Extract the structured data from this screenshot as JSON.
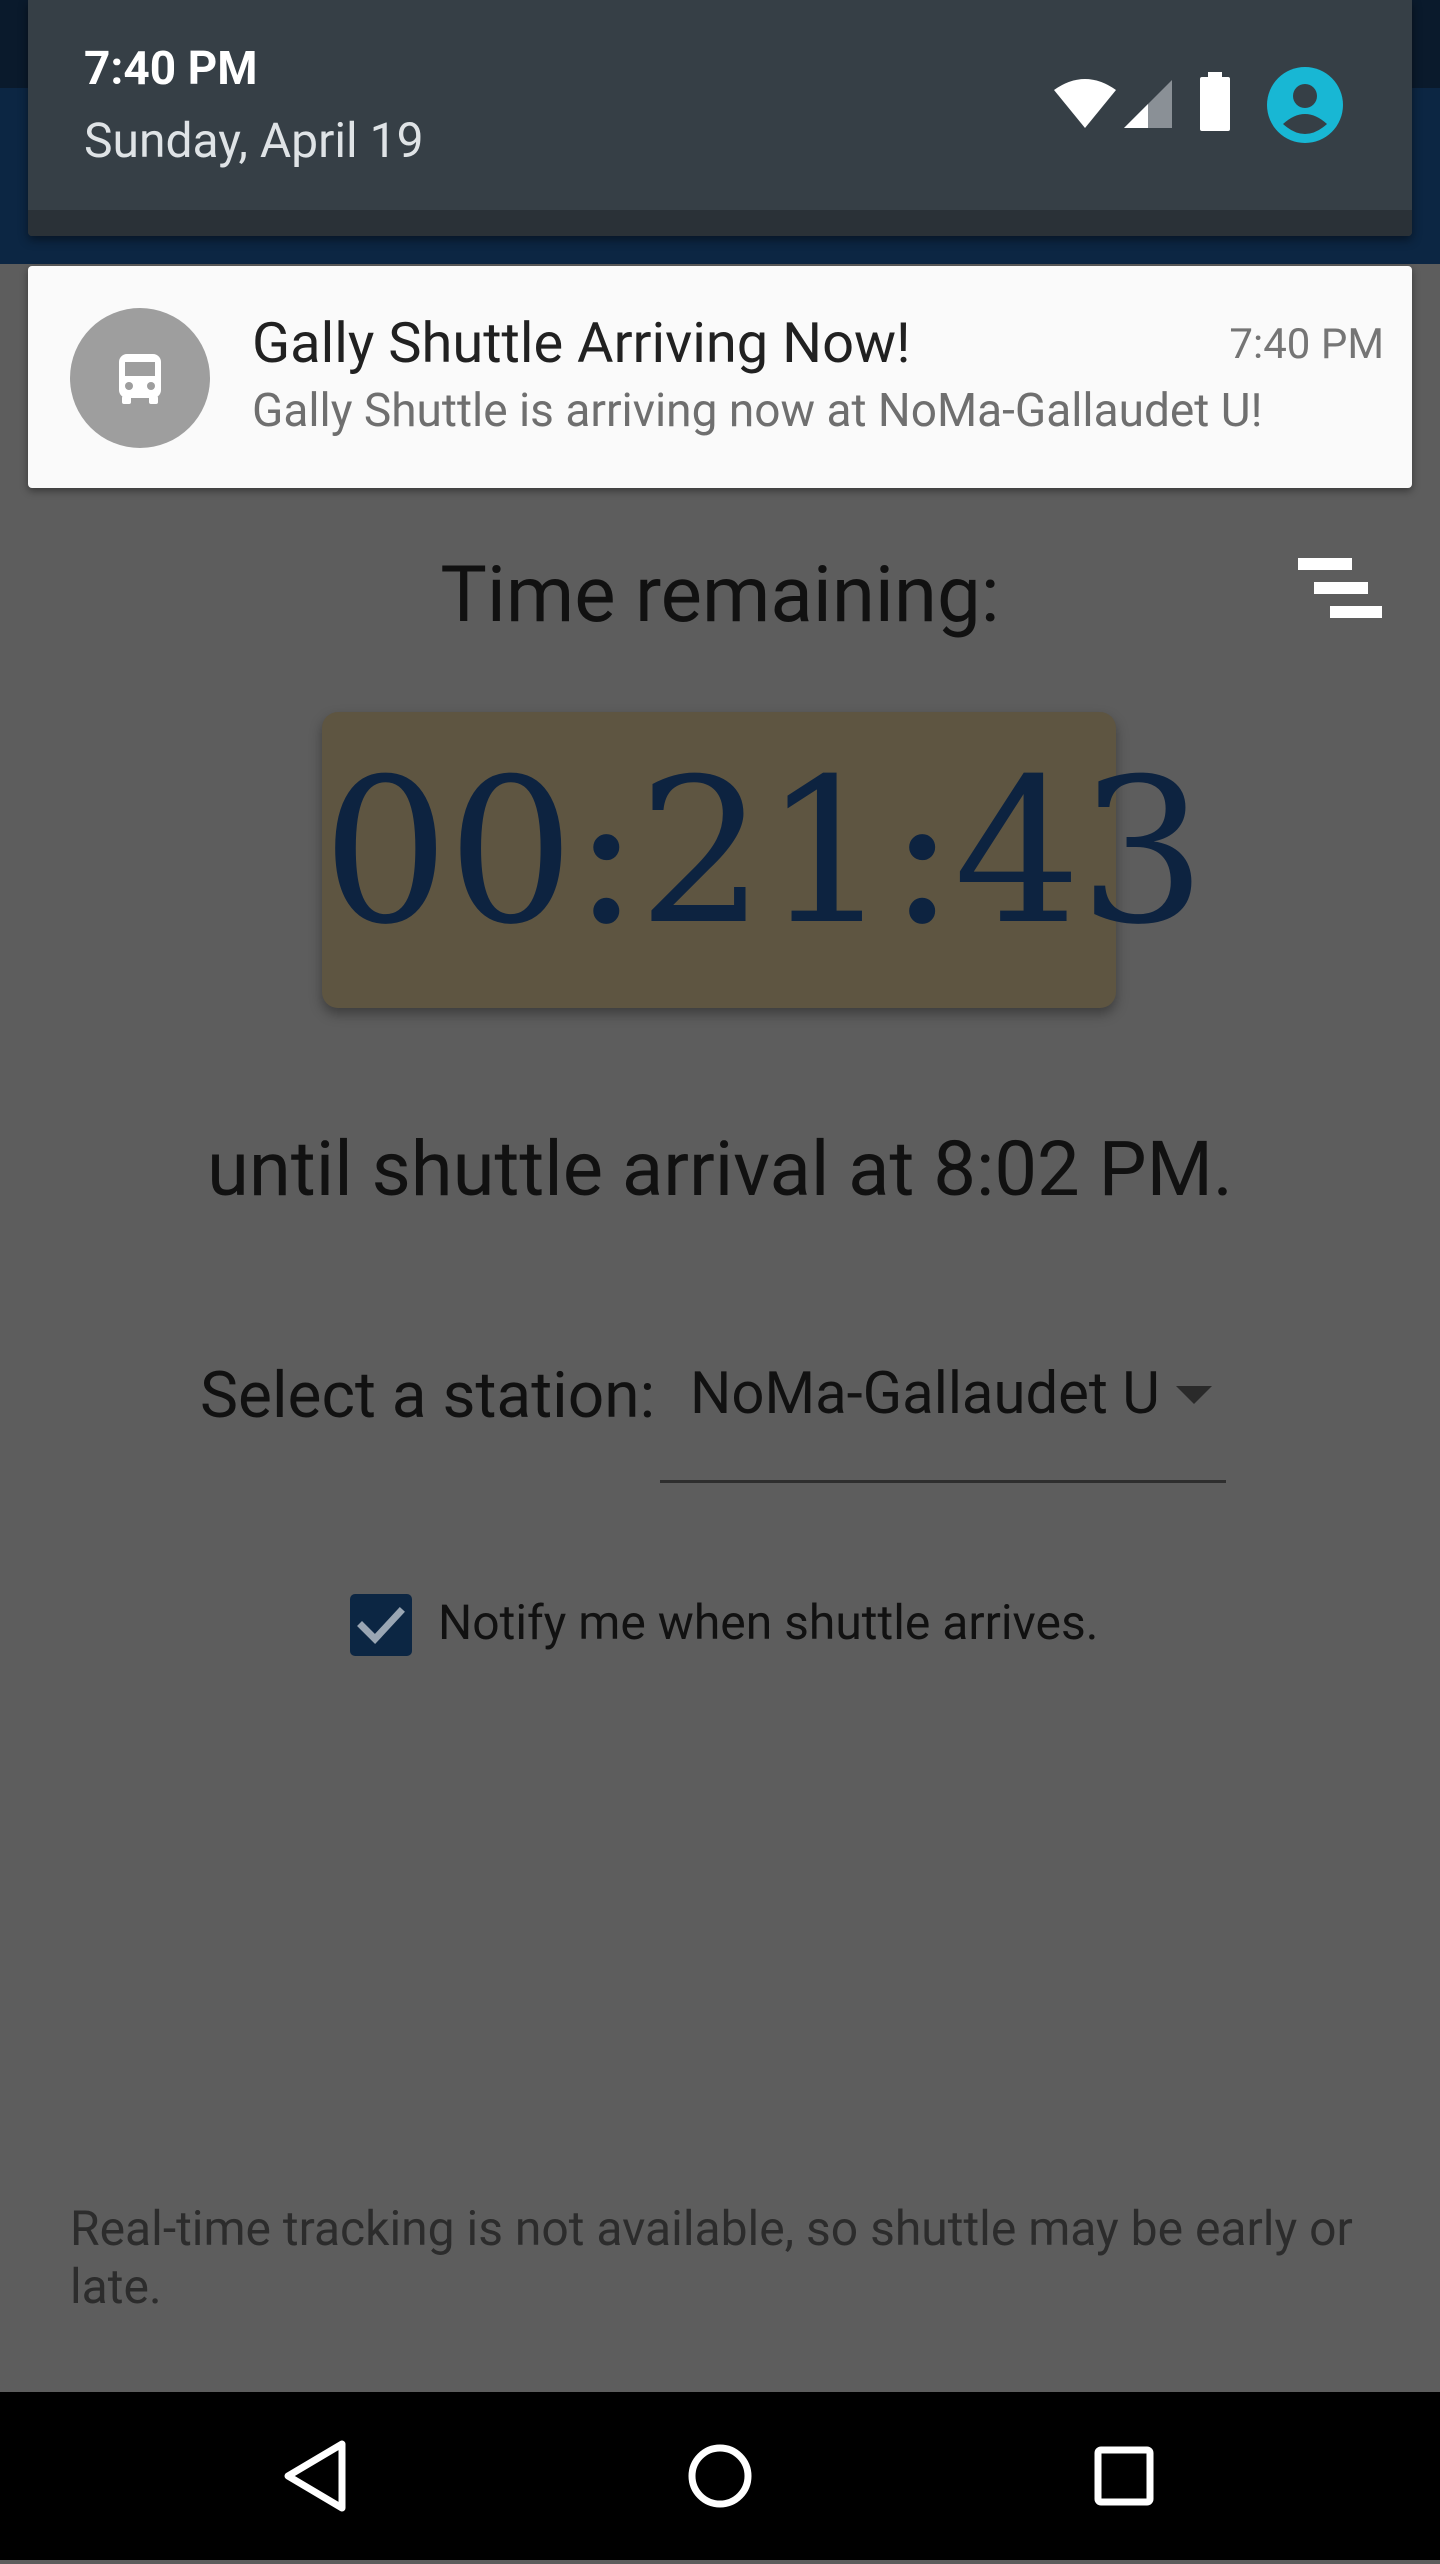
{
  "status_bar": {
    "time": "7:40 PM",
    "date": "Sunday, April 19",
    "icons": [
      "wifi-icon",
      "cellular-signal-icon",
      "battery-icon",
      "account-icon"
    ],
    "account_color": "#18b7d4"
  },
  "notification": {
    "title": "Gally Shuttle Arriving Now!",
    "time": "7:40 PM",
    "text": "Gally Shuttle is arriving now at NoMa-Gallaudet U!",
    "icon": "bus-icon"
  },
  "main": {
    "time_remaining_label": "Time remaining:",
    "timer": "00:21:43",
    "until_text": "until shuttle arrival at 8:02 PM.",
    "select_label": "Select a station:",
    "selected_station": "NoMa-Gallaudet U",
    "notify_label": "Notify me when shuttle arrives.",
    "notify_checked": true,
    "footer_note": "Real-time tracking is not available, so shuttle may be early or late.",
    "menu_icon": "view-stack-icon"
  },
  "navigation": {
    "buttons": [
      "back-icon",
      "home-icon",
      "recents-icon"
    ]
  },
  "colors": {
    "brand_navy": "#0c2643",
    "timer_bg": "#5e5541",
    "scrim": "#5d5d5d"
  }
}
